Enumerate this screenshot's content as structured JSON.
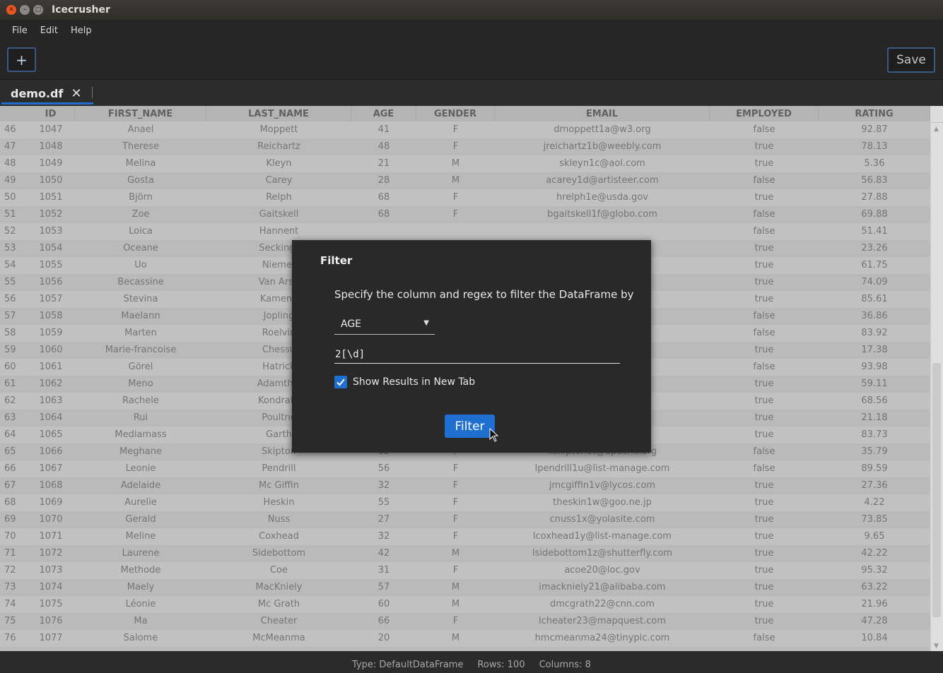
{
  "window": {
    "title": "Icecrusher"
  },
  "menu": [
    "File",
    "Edit",
    "Help"
  ],
  "toolbar": {
    "add_label": "+",
    "save_label": "Save"
  },
  "tab": {
    "label": "demo.df",
    "close": "✕"
  },
  "columns": [
    "ID",
    "FIRST_NAME",
    "LAST_NAME",
    "AGE",
    "GENDER",
    "EMAIL",
    "EMPLOYED",
    "RATING"
  ],
  "rows": [
    [
      "46",
      "1047",
      "Anael",
      "Moppett",
      "41",
      "F",
      "dmoppett1a@w3.org",
      "false",
      "92.87"
    ],
    [
      "47",
      "1048",
      "Therese",
      "Reichartz",
      "48",
      "F",
      "jreichartz1b@weebly.com",
      "true",
      "78.13"
    ],
    [
      "48",
      "1049",
      "Melina",
      "Kleyn",
      "21",
      "M",
      "skleyn1c@aol.com",
      "true",
      "5.36"
    ],
    [
      "49",
      "1050",
      "Gosta",
      "Carey",
      "28",
      "M",
      "acarey1d@artisteer.com",
      "false",
      "56.83"
    ],
    [
      "50",
      "1051",
      "Björn",
      "Relph",
      "68",
      "F",
      "hrelph1e@usda.gov",
      "true",
      "27.88"
    ],
    [
      "51",
      "1052",
      "Zoe",
      "Gaitskell",
      "68",
      "F",
      "bgaitskell1f@globo.com",
      "false",
      "69.88"
    ],
    [
      "52",
      "1053",
      "Loica",
      "Hannent",
      "",
      "",
      "",
      "false",
      "51.41"
    ],
    [
      "53",
      "1054",
      "Oceane",
      "Seckingt",
      "",
      "",
      "re.com",
      "true",
      "23.26"
    ],
    [
      "54",
      "1055",
      "Uo",
      "Niemet",
      "",
      "",
      "",
      "true",
      "61.75"
    ],
    [
      "55",
      "1056",
      "Becassine",
      "Van Arsd",
      "",
      "",
      "com",
      "true",
      "74.09"
    ],
    [
      "56",
      "1057",
      "Stevina",
      "Kamena",
      "",
      "",
      "",
      "true",
      "85.61"
    ],
    [
      "57",
      "1058",
      "Maelann",
      "Jopling",
      "",
      "",
      "",
      "false",
      "36.86"
    ],
    [
      "58",
      "1059",
      "Marten",
      "Roelvin",
      "",
      "",
      "m",
      "false",
      "83.92"
    ],
    [
      "59",
      "1060",
      "Marie-francoise",
      "Chessu",
      "",
      "",
      "",
      "true",
      "17.38"
    ],
    [
      "60",
      "1061",
      "Görel",
      "Hatrick",
      "",
      "",
      "om",
      "false",
      "93.98"
    ],
    [
      "61",
      "1062",
      "Meno",
      "Adamthw",
      "",
      "",
      ".com",
      "true",
      "59.11"
    ],
    [
      "62",
      "1063",
      "Rachele",
      "Kondrate",
      "",
      "",
      "om",
      "true",
      "68.56"
    ],
    [
      "63",
      "1064",
      "Rui",
      "Poultne",
      "",
      "",
      "info",
      "true",
      "21.18"
    ],
    [
      "64",
      "1065",
      "Mediamass",
      "Garth",
      "",
      "",
      "",
      "true",
      "83.73"
    ],
    [
      "65",
      "1066",
      "Meghane",
      "Skipton",
      "32",
      "F",
      "kskipton1t@apache.org",
      "false",
      "35.79"
    ],
    [
      "66",
      "1067",
      "Leonie",
      "Pendrill",
      "56",
      "F",
      "lpendrill1u@list-manage.com",
      "false",
      "89.59"
    ],
    [
      "67",
      "1068",
      "Adelaide",
      "Mc Giffin",
      "32",
      "F",
      "jmcgiffin1v@lycos.com",
      "true",
      "27.36"
    ],
    [
      "68",
      "1069",
      "Aurelie",
      "Heskin",
      "55",
      "F",
      "theskin1w@goo.ne.jp",
      "true",
      "4.22"
    ],
    [
      "69",
      "1070",
      "Gerald",
      "Nuss",
      "27",
      "F",
      "cnuss1x@yolasite.com",
      "true",
      "73.85"
    ],
    [
      "70",
      "1071",
      "Meline",
      "Coxhead",
      "32",
      "F",
      "lcoxhead1y@list-manage.com",
      "true",
      "9.65"
    ],
    [
      "71",
      "1072",
      "Laurene",
      "Sidebottom",
      "42",
      "M",
      "lsidebottom1z@shutterfly.com",
      "true",
      "42.22"
    ],
    [
      "72",
      "1073",
      "Methode",
      "Coe",
      "31",
      "F",
      "acoe20@loc.gov",
      "true",
      "95.32"
    ],
    [
      "73",
      "1074",
      "Maely",
      "MacKniely",
      "57",
      "M",
      "imackniely21@alibaba.com",
      "true",
      "63.22"
    ],
    [
      "74",
      "1075",
      "Léonie",
      "Mc Grath",
      "60",
      "M",
      "dmcgrath22@cnn.com",
      "true",
      "21.96"
    ],
    [
      "75",
      "1076",
      "Ma",
      "Cheater",
      "66",
      "F",
      "lcheater23@mapquest.com",
      "true",
      "47.28"
    ],
    [
      "76",
      "1077",
      "Salome",
      "McMeanma",
      "20",
      "M",
      "hmcmeanma24@tinypic.com",
      "false",
      "10.84"
    ]
  ],
  "status": {
    "type": "Type:  DefaultDataFrame",
    "rows": "Rows:  100",
    "columns": "Columns:  8"
  },
  "dialog": {
    "title": "Filter",
    "description": "Specify the column and regex to filter the DataFrame by",
    "column_value": "AGE",
    "regex_value": "2[\\d]",
    "checkbox_label": "Show Results in New Tab",
    "checkbox_checked": true,
    "button_label": "Filter"
  },
  "colors": {
    "accent": "#1e6fd0",
    "close_button": "#e95420"
  }
}
